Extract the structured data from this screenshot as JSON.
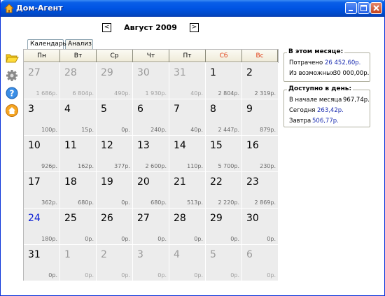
{
  "window": {
    "title": "Дом-Агент",
    "controls": [
      "minimize-icon",
      "maximize-icon",
      "close-icon"
    ]
  },
  "header": {
    "month_title": "Август 2009",
    "prev_label": "<",
    "next_label": ">"
  },
  "tabs": [
    {
      "label": "Календарь",
      "active": true
    },
    {
      "label": "Анализ",
      "active": false
    }
  ],
  "sidebar_icons": [
    "folder-icon",
    "gear-icon",
    "help-icon",
    "home-icon"
  ],
  "calendar": {
    "weekdays": [
      "Пн",
      "Вт",
      "Ср",
      "Чт",
      "Пт",
      "Сб",
      "Вс"
    ],
    "weeks": [
      [
        {
          "d": "27",
          "a": "1 686р.",
          "o": true
        },
        {
          "d": "28",
          "a": "6 804р.",
          "o": true
        },
        {
          "d": "29",
          "a": "490р.",
          "o": true
        },
        {
          "d": "30",
          "a": "1 930р.",
          "o": true
        },
        {
          "d": "31",
          "a": "40р.",
          "o": true
        },
        {
          "d": "1",
          "a": "2 804р."
        },
        {
          "d": "2",
          "a": "2 319р."
        }
      ],
      [
        {
          "d": "3",
          "a": "100р."
        },
        {
          "d": "4",
          "a": "15р."
        },
        {
          "d": "5",
          "a": "0р."
        },
        {
          "d": "6",
          "a": "240р."
        },
        {
          "d": "7",
          "a": "40р."
        },
        {
          "d": "8",
          "a": "2 447р."
        },
        {
          "d": "9",
          "a": "879р."
        }
      ],
      [
        {
          "d": "10",
          "a": "926р."
        },
        {
          "d": "11",
          "a": "162р."
        },
        {
          "d": "12",
          "a": "377р."
        },
        {
          "d": "13",
          "a": "2 600р."
        },
        {
          "d": "14",
          "a": "110р."
        },
        {
          "d": "15",
          "a": "5 700р."
        },
        {
          "d": "16",
          "a": "230р."
        }
      ],
      [
        {
          "d": "17",
          "a": "362р."
        },
        {
          "d": "18",
          "a": "680р."
        },
        {
          "d": "19",
          "a": "0р."
        },
        {
          "d": "20",
          "a": "680р."
        },
        {
          "d": "21",
          "a": "513р."
        },
        {
          "d": "22",
          "a": "2 220р."
        },
        {
          "d": "23",
          "a": "2 869р."
        }
      ],
      [
        {
          "d": "24",
          "a": "180р.",
          "today": true
        },
        {
          "d": "25",
          "a": "0р."
        },
        {
          "d": "26",
          "a": "0р."
        },
        {
          "d": "27",
          "a": "0р."
        },
        {
          "d": "28",
          "a": "0р."
        },
        {
          "d": "29",
          "a": "0р."
        },
        {
          "d": "30",
          "a": "0р."
        }
      ],
      [
        {
          "d": "31",
          "a": "0р."
        },
        {
          "d": "1",
          "a": "0р.",
          "o": true
        },
        {
          "d": "2",
          "a": "0р.",
          "o": true
        },
        {
          "d": "3",
          "a": "0р.",
          "o": true
        },
        {
          "d": "4",
          "a": "0р.",
          "o": true
        },
        {
          "d": "5",
          "a": "0р.",
          "o": true
        },
        {
          "d": "6",
          "a": "0р.",
          "o": true
        }
      ]
    ]
  },
  "month_panel": {
    "title": "В этом месяце:",
    "spent_label": "Потрачено",
    "spent_value": "26 452,60р.",
    "possible_label": "Из возможных",
    "possible_value": "30 000,00р."
  },
  "daily_panel": {
    "title": "Доступно в день:",
    "start_label": "В начале месяца",
    "start_value": "967,74р.",
    "today_label": "Сегодня",
    "today_value": "263,42р.",
    "tomorrow_label": "Завтра",
    "tomorrow_value": "506,77р."
  },
  "colors": {
    "titlebar": "#0054e3",
    "weekend": "#e03b12",
    "today": "#0c1fd4",
    "value_blue": "#1a2cb0",
    "cell_bg": "#ececec"
  }
}
